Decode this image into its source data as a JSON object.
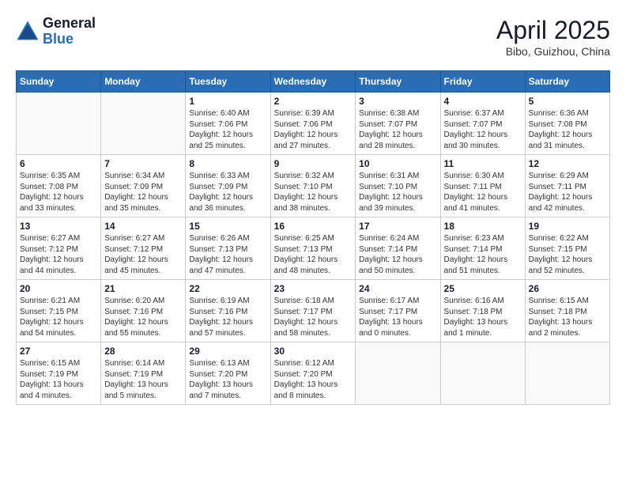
{
  "logo": {
    "general": "General",
    "blue": "Blue"
  },
  "title": "April 2025",
  "location": "Bibo, Guizhou, China",
  "weekdays": [
    "Sunday",
    "Monday",
    "Tuesday",
    "Wednesday",
    "Thursday",
    "Friday",
    "Saturday"
  ],
  "weeks": [
    [
      {
        "day": "",
        "content": ""
      },
      {
        "day": "",
        "content": ""
      },
      {
        "day": "1",
        "content": "Sunrise: 6:40 AM\nSunset: 7:06 PM\nDaylight: 12 hours and 25 minutes."
      },
      {
        "day": "2",
        "content": "Sunrise: 6:39 AM\nSunset: 7:06 PM\nDaylight: 12 hours and 27 minutes."
      },
      {
        "day": "3",
        "content": "Sunrise: 6:38 AM\nSunset: 7:07 PM\nDaylight: 12 hours and 28 minutes."
      },
      {
        "day": "4",
        "content": "Sunrise: 6:37 AM\nSunset: 7:07 PM\nDaylight: 12 hours and 30 minutes."
      },
      {
        "day": "5",
        "content": "Sunrise: 6:36 AM\nSunset: 7:08 PM\nDaylight: 12 hours and 31 minutes."
      }
    ],
    [
      {
        "day": "6",
        "content": "Sunrise: 6:35 AM\nSunset: 7:08 PM\nDaylight: 12 hours and 33 minutes."
      },
      {
        "day": "7",
        "content": "Sunrise: 6:34 AM\nSunset: 7:09 PM\nDaylight: 12 hours and 35 minutes."
      },
      {
        "day": "8",
        "content": "Sunrise: 6:33 AM\nSunset: 7:09 PM\nDaylight: 12 hours and 36 minutes."
      },
      {
        "day": "9",
        "content": "Sunrise: 6:32 AM\nSunset: 7:10 PM\nDaylight: 12 hours and 38 minutes."
      },
      {
        "day": "10",
        "content": "Sunrise: 6:31 AM\nSunset: 7:10 PM\nDaylight: 12 hours and 39 minutes."
      },
      {
        "day": "11",
        "content": "Sunrise: 6:30 AM\nSunset: 7:11 PM\nDaylight: 12 hours and 41 minutes."
      },
      {
        "day": "12",
        "content": "Sunrise: 6:29 AM\nSunset: 7:11 PM\nDaylight: 12 hours and 42 minutes."
      }
    ],
    [
      {
        "day": "13",
        "content": "Sunrise: 6:27 AM\nSunset: 7:12 PM\nDaylight: 12 hours and 44 minutes."
      },
      {
        "day": "14",
        "content": "Sunrise: 6:27 AM\nSunset: 7:12 PM\nDaylight: 12 hours and 45 minutes."
      },
      {
        "day": "15",
        "content": "Sunrise: 6:26 AM\nSunset: 7:13 PM\nDaylight: 12 hours and 47 minutes."
      },
      {
        "day": "16",
        "content": "Sunrise: 6:25 AM\nSunset: 7:13 PM\nDaylight: 12 hours and 48 minutes."
      },
      {
        "day": "17",
        "content": "Sunrise: 6:24 AM\nSunset: 7:14 PM\nDaylight: 12 hours and 50 minutes."
      },
      {
        "day": "18",
        "content": "Sunrise: 6:23 AM\nSunset: 7:14 PM\nDaylight: 12 hours and 51 minutes."
      },
      {
        "day": "19",
        "content": "Sunrise: 6:22 AM\nSunset: 7:15 PM\nDaylight: 12 hours and 52 minutes."
      }
    ],
    [
      {
        "day": "20",
        "content": "Sunrise: 6:21 AM\nSunset: 7:15 PM\nDaylight: 12 hours and 54 minutes."
      },
      {
        "day": "21",
        "content": "Sunrise: 6:20 AM\nSunset: 7:16 PM\nDaylight: 12 hours and 55 minutes."
      },
      {
        "day": "22",
        "content": "Sunrise: 6:19 AM\nSunset: 7:16 PM\nDaylight: 12 hours and 57 minutes."
      },
      {
        "day": "23",
        "content": "Sunrise: 6:18 AM\nSunset: 7:17 PM\nDaylight: 12 hours and 58 minutes."
      },
      {
        "day": "24",
        "content": "Sunrise: 6:17 AM\nSunset: 7:17 PM\nDaylight: 13 hours and 0 minutes."
      },
      {
        "day": "25",
        "content": "Sunrise: 6:16 AM\nSunset: 7:18 PM\nDaylight: 13 hours and 1 minute."
      },
      {
        "day": "26",
        "content": "Sunrise: 6:15 AM\nSunset: 7:18 PM\nDaylight: 13 hours and 2 minutes."
      }
    ],
    [
      {
        "day": "27",
        "content": "Sunrise: 6:15 AM\nSunset: 7:19 PM\nDaylight: 13 hours and 4 minutes."
      },
      {
        "day": "28",
        "content": "Sunrise: 6:14 AM\nSunset: 7:19 PM\nDaylight: 13 hours and 5 minutes."
      },
      {
        "day": "29",
        "content": "Sunrise: 6:13 AM\nSunset: 7:20 PM\nDaylight: 13 hours and 7 minutes."
      },
      {
        "day": "30",
        "content": "Sunrise: 6:12 AM\nSunset: 7:20 PM\nDaylight: 13 hours and 8 minutes."
      },
      {
        "day": "",
        "content": ""
      },
      {
        "day": "",
        "content": ""
      },
      {
        "day": "",
        "content": ""
      }
    ]
  ]
}
